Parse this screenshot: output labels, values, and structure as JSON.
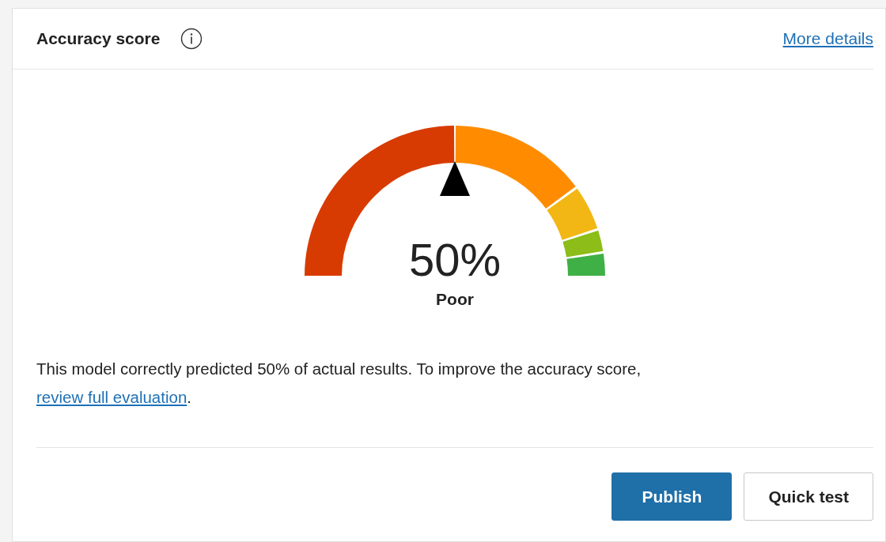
{
  "card": {
    "title": "Accuracy score",
    "details_link": "More details"
  },
  "gauge": {
    "level": 0.5,
    "value": "50%",
    "rating": "Poor"
  },
  "description": {
    "text": "This model correctly predicted 50% of actual results. To improve the accuracy score, ",
    "link": "review full evaluation",
    "after": "."
  },
  "buttons": [
    {
      "label": "Publish",
      "kind": "primary"
    },
    {
      "label": "Quick test",
      "kind": "secondary"
    }
  ]
}
